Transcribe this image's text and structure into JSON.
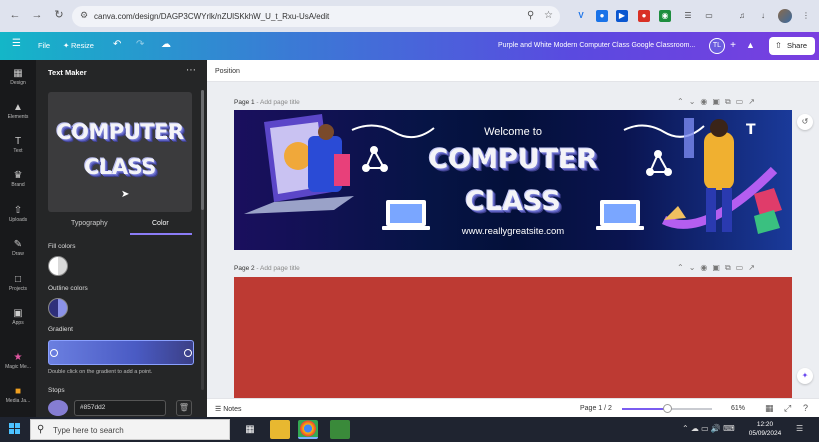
{
  "browser": {
    "url": "canva.com/design/DAGP3CWYrlk/nZUlSKkhW_U_t_Rxu-UsA/edit"
  },
  "header": {
    "file_label": "File",
    "resize_label": "Resize",
    "doc_title": "Purple and White Modern Computer Class Google Classroom...",
    "avatar_initials": "TL",
    "share_label": "Share"
  },
  "rail": {
    "items": [
      {
        "label": "Design",
        "icon": "design-icon"
      },
      {
        "label": "Elements",
        "icon": "elements-icon"
      },
      {
        "label": "Text",
        "icon": "text-icon"
      },
      {
        "label": "Brand",
        "icon": "brand-icon"
      },
      {
        "label": "Uploads",
        "icon": "uploads-icon"
      },
      {
        "label": "Draw",
        "icon": "draw-icon"
      },
      {
        "label": "Projects",
        "icon": "projects-icon"
      },
      {
        "label": "Apps",
        "icon": "apps-icon"
      },
      {
        "label": "Magic Me...",
        "icon": "magic-media-icon"
      },
      {
        "label": "Media Ja...",
        "icon": "media-app-icon"
      }
    ]
  },
  "panel": {
    "title": "Text Maker",
    "preview_line1": "COMPUTER",
    "preview_line2": "CLASS",
    "tabs": [
      "Typography",
      "Color"
    ],
    "active_tab": "Color",
    "fill_colors_label": "Fill colors",
    "outline_colors_label": "Outline colors",
    "gradient_label": "Gradient",
    "gradient_hint": "Double click on the gradient to add a point.",
    "stops_label": "Stops",
    "stop_hex": "#857dd2",
    "stop_color": "#857dd2"
  },
  "editor": {
    "toolbar_label": "Position",
    "page1_label": "Page 1",
    "page1_sub": "- Add page title",
    "page2_label": "Page 2",
    "page2_sub": "- Add page title",
    "banner": {
      "welcome": "Welcome to",
      "line1": "COMPUTER",
      "line2": "CLASS",
      "website": "www.reallygreatsite.com"
    },
    "page2_color": "#bd3a33"
  },
  "bottombar": {
    "notes_label": "Notes",
    "page_indicator": "Page 1 / 2",
    "zoom_label": "61%",
    "zoom_fraction": 0.5
  },
  "taskbar": {
    "search_placeholder": "Type here to search",
    "time": "12:20",
    "date": "05/09/2024"
  }
}
